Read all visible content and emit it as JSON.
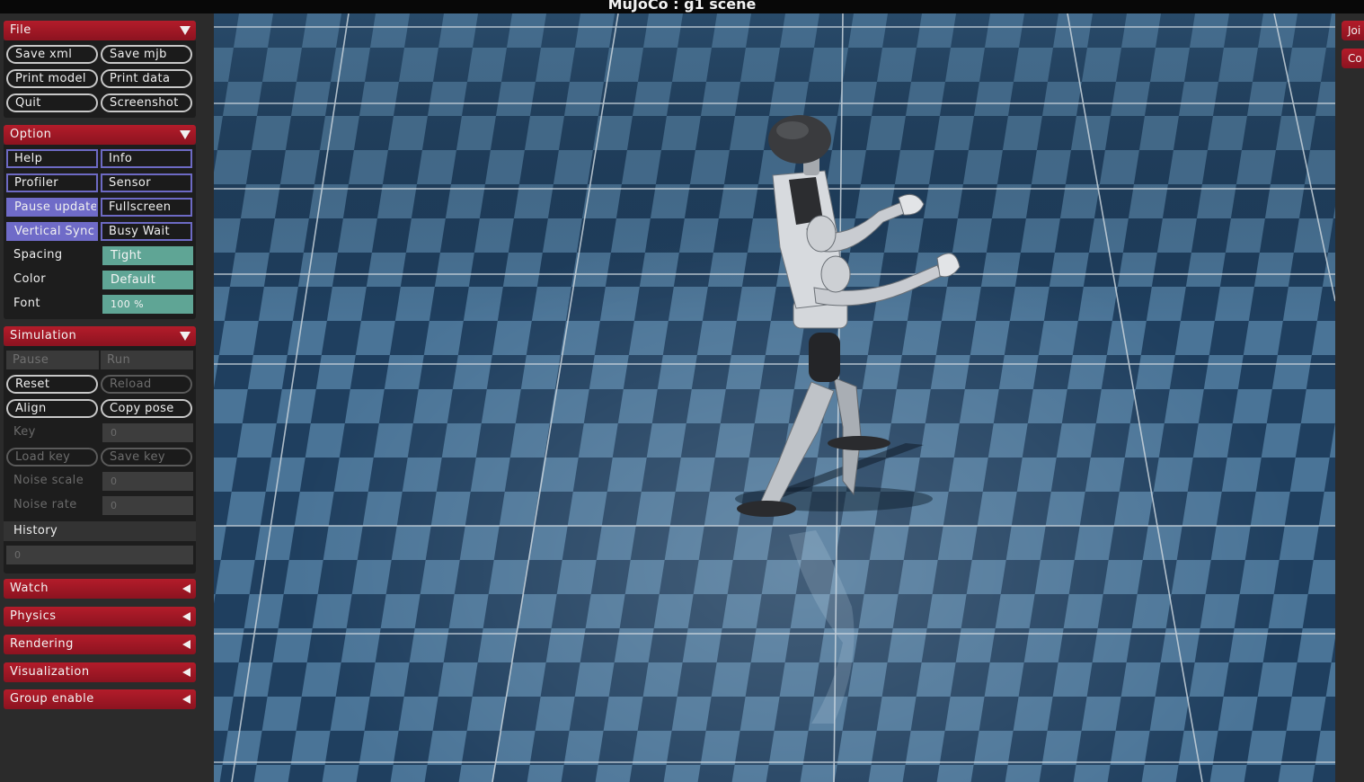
{
  "window": {
    "title": "MuJoCo : g1 scene"
  },
  "file": {
    "header": "File",
    "buttons": {
      "save_xml": "Save xml",
      "save_mjb": "Save mjb",
      "print_model": "Print model",
      "print_data": "Print data",
      "quit": "Quit",
      "screenshot": "Screenshot"
    }
  },
  "option": {
    "header": "Option",
    "toggles": {
      "help": "Help",
      "info": "Info",
      "profiler": "Profiler",
      "sensor": "Sensor",
      "pause_update": "Pause update",
      "fullscreen": "Fullscreen",
      "vertical_sync": "Vertical Sync",
      "busy_wait": "Busy Wait"
    },
    "spacing": {
      "label": "Spacing",
      "value": "Tight"
    },
    "color": {
      "label": "Color",
      "value": "Default"
    },
    "font": {
      "label": "Font",
      "value": "100 %"
    }
  },
  "simulation": {
    "header": "Simulation",
    "pause": "Pause",
    "run": "Run",
    "reset": "Reset",
    "reload": "Reload",
    "align": "Align",
    "copy_pose": "Copy pose",
    "key": {
      "label": "Key",
      "value": "0"
    },
    "load_key": "Load key",
    "save_key": "Save key",
    "noise_scale": {
      "label": "Noise scale",
      "value": "0"
    },
    "noise_rate": {
      "label": "Noise rate",
      "value": "0"
    },
    "history": {
      "label": "History",
      "value": "0"
    }
  },
  "collapsed_sections": {
    "watch": "Watch",
    "physics": "Physics",
    "rendering": "Rendering",
    "visualization": "Visualization",
    "group_enable": "Group enable"
  },
  "right_panel": {
    "tab1": "Joi",
    "tab2": "Co"
  },
  "colors": {
    "section_header": "#a31826",
    "toggle_on": "#6f6bc8",
    "select_value": "#5fa595",
    "floor_dark": "#1e3d5c",
    "floor_light": "#4b7597"
  }
}
